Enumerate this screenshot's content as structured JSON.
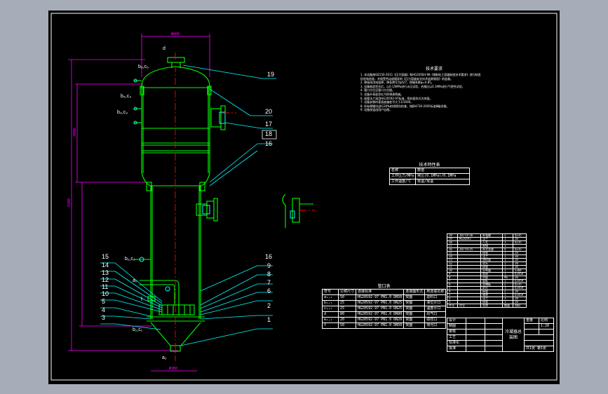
{
  "tags": {
    "d": "d",
    "b5c5": "b₅,c₅",
    "b4c4": "b₄,c₄",
    "b3c3": "b₃,c₃",
    "b2c2": "b₂,c₂",
    "b1c1": "b₁,c₁",
    "a1": "a₁",
    "a2": "a₂",
    "f": "f"
  },
  "dims": {
    "top_width": "Φ800",
    "bottom_width": "Φ300",
    "overall_height": "5500",
    "shell_height": "3000"
  },
  "part_numbers_left": [
    "15",
    "14",
    "13",
    "12",
    "11",
    "10",
    "5",
    "4",
    "3"
  ],
  "part_numbers_right": [
    "19",
    "20",
    "17",
    "18",
    "16",
    "16",
    "9",
    "8",
    "7",
    "6",
    "2",
    "1"
  ],
  "notes": {
    "title": "技术要求",
    "lines": [
      "1. 本设备按GB150-2011《压力容器》和HG20584-98《钢制化工容器制造技术要求》进行制造",
      "   检验和验收，并接受劳动部颁发的《压力容器安全技术监察规程》的监督。",
      "2. 焊接采用电弧焊，焊条牌号为J427，焊缝系数φ=0.85。",
      "3. 设备制造完毕后，以0.15MPa进行水压试验，合格后以0.1MPa进行气密性试验。",
      "4. 管口方位见管口方位图。",
      "5. 设备外表面涂红丹防锈漆两遍。",
      "6. 接管法兰采用HG20592-97标准，密封面形式为突面。",
      "7. 设备安装时垂直度偏差不大于1/1000。",
      "8. 所有焊缝均进行20%射线探伤检查，按JB4730-2005标准Ⅲ级合格。",
      "9. 设备保温由用户自理。"
    ]
  },
  "design_table": {
    "title": "技术特性表",
    "header": [
      "名称",
      "数值"
    ],
    "rows": [
      [
        "工作压力/MPa",
        "常压(0.1MPa)/0.1MPa"
      ],
      [
        "工作温度/℃",
        "常温/常温"
      ]
    ]
  },
  "nozzle_table": {
    "title": "管口表",
    "header": [
      "符号",
      "公称尺寸",
      "连接标准",
      "连接面形式",
      "用途或名称"
    ],
    "rows": [
      [
        "a₁,₂",
        "50",
        "HG20592-97 PN1.0 DN50",
        "突面",
        "进料口"
      ],
      [
        "b₁,₅",
        "25",
        "HG20592-97 PN1.0 DN25",
        "突面",
        "液位计口"
      ],
      [
        "c₁,₅",
        "25",
        "HG20592-97 PN1.0 DN25",
        "突面",
        "温度计口"
      ],
      [
        "d",
        "80",
        "HG20592-97 PN1.0 DN80",
        "突面",
        "出气口"
      ],
      [
        "e₁,₂",
        "20",
        "HG20592-97 PN1.0 DN20",
        "突面",
        "取样口"
      ],
      [
        "f",
        "50",
        "HG20592-97 PN1.0 DN50",
        "突面",
        "排污口"
      ]
    ]
  },
  "parts_list": {
    "rows": [
      [
        "20",
        "JB/T4736",
        "补强圈",
        "2",
        "Q235"
      ],
      [
        "19",
        "HG20592",
        "法兰",
        "1",
        "20"
      ],
      [
        "18",
        "",
        "人孔",
        "1",
        "Q235"
      ],
      [
        "17",
        "",
        "视镜",
        "1",
        ""
      ],
      [
        "16",
        "JB/T4725",
        "耳式支座",
        "4",
        "Q235"
      ],
      [
        "15",
        "",
        "接管",
        "1",
        "20"
      ],
      [
        "14",
        "",
        "法兰",
        "1",
        "20"
      ],
      [
        "13",
        "",
        "进料管",
        "1",
        "20"
      ],
      [
        "12",
        "",
        "弯头",
        "1",
        "20"
      ],
      [
        "11",
        "",
        "接管",
        "1",
        "20"
      ],
      [
        "10",
        "",
        "分布器",
        "1",
        "S304"
      ],
      [
        "9",
        "",
        "筒体",
        "1",
        "Q345R"
      ],
      [
        "8",
        "",
        "列管",
        "96",
        "20"
      ],
      [
        "7",
        "",
        "管板",
        "1",
        "Q345R"
      ],
      [
        "6",
        "",
        "支撑板",
        "2",
        "Q235"
      ],
      [
        "5",
        "",
        "封头",
        "1",
        "Q345R"
      ],
      [
        "4",
        "",
        "接管",
        "2",
        "20"
      ],
      [
        "3",
        "",
        "锥底",
        "1",
        "Q345R"
      ],
      [
        "2",
        "",
        "法兰",
        "1",
        "20"
      ],
      [
        "1",
        "",
        "接管",
        "1",
        "20"
      ]
    ],
    "header": [
      "件号",
      "代号",
      "名称",
      "数量",
      "材料"
    ]
  },
  "title_block": {
    "drawing_title": "冷凝器总装图",
    "scale_label": "比例",
    "scale": "1:20",
    "sheet": "共1张 第1张",
    "rows": [
      "设计",
      "制图",
      "审核",
      "工艺",
      "标准化",
      "批准"
    ],
    "weight_label": "重量"
  },
  "colors": {
    "background": "#000000",
    "frame": "#ffffff",
    "vessel": "#00ff00",
    "centerline": "#ff0000",
    "leader": "#00ffff",
    "dimension": "#ff00ff",
    "nozzle": "#00ffff"
  }
}
